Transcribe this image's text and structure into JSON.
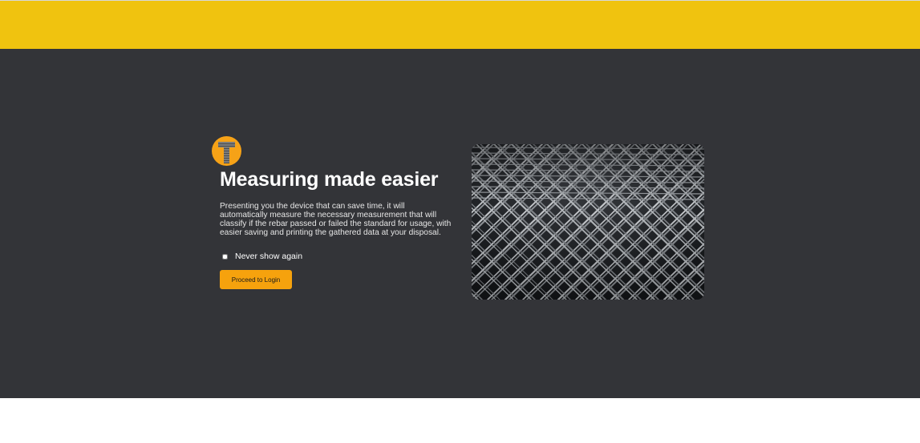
{
  "colors": {
    "accent_yellow": "#f0c30f",
    "background_dark": "#333438",
    "button_orange": "#f6a20d",
    "logo_orange": "#f6a217"
  },
  "logo": {
    "icon": "rebar-t-logo-icon"
  },
  "intro": {
    "title": "Measuring made easier",
    "description": "Presenting you the device that can save time, it will automatically measure the necessary measurement that will classify if the rebar passed or failed the standard for usage, with easier saving and printing the gathered data at your disposal.",
    "never_show_label": "Never show again",
    "never_show_checked": false,
    "proceed_label": "Proceed to Login"
  },
  "hero": {
    "icon": "rebar-mesh-image"
  }
}
